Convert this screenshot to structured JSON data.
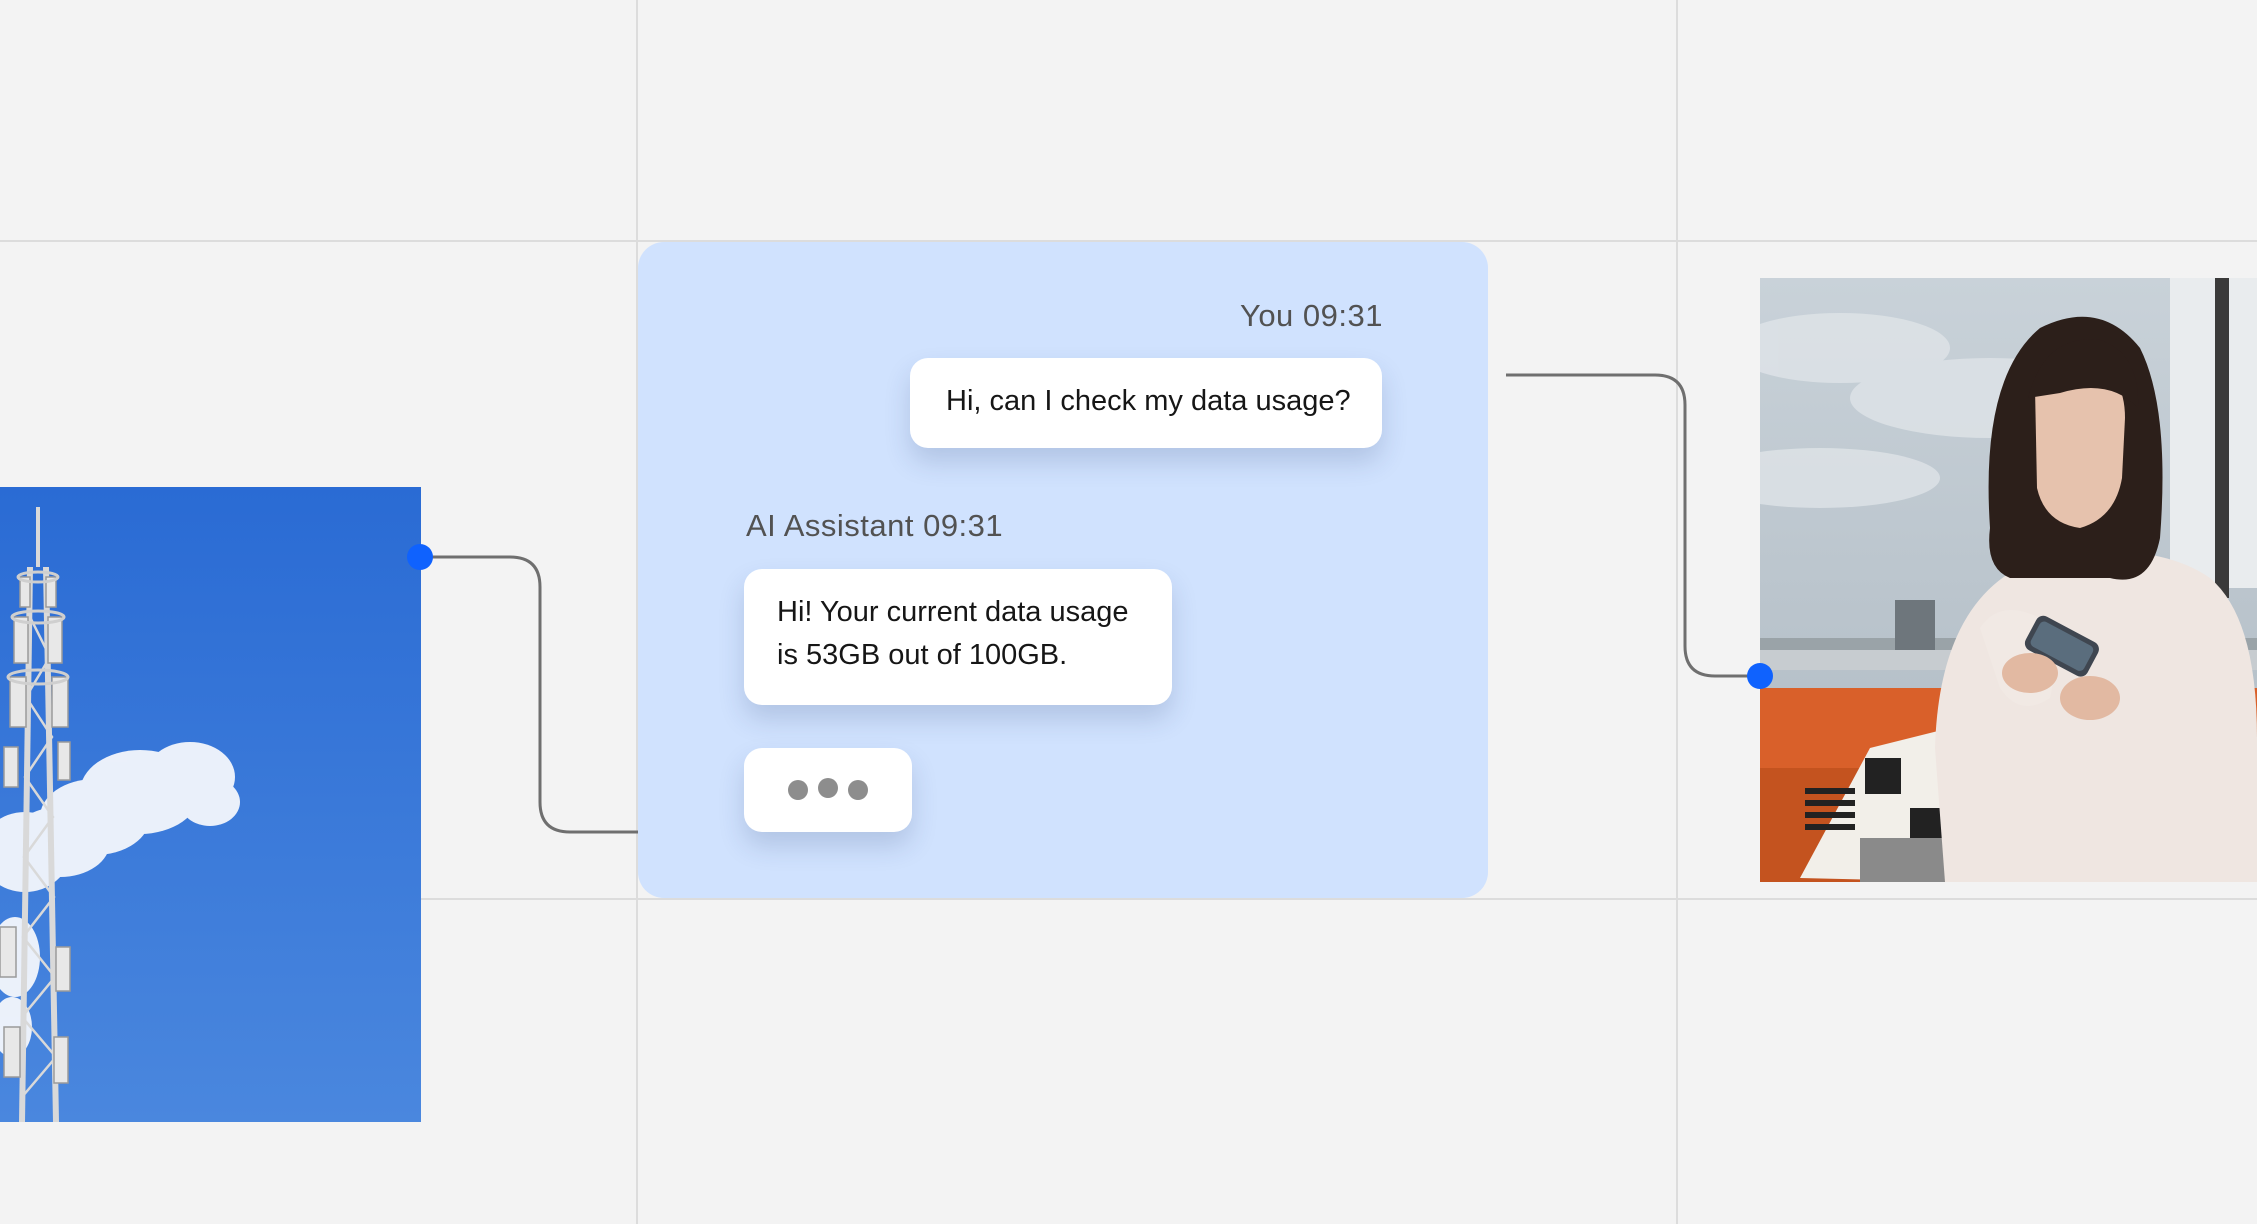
{
  "chat": {
    "messages": [
      {
        "sender": "You",
        "time": "09:31",
        "header": "You 09:31",
        "text": "Hi, can I check my data usage?"
      },
      {
        "sender": "AI Assistant",
        "time": "09:31",
        "header": "AI Assistant 09:31",
        "text": "Hi! Your current data usage is 53GB out of 100GB."
      }
    ],
    "typing_indicator": true
  },
  "colors": {
    "background": "#f3f3f3",
    "panel": "#d0e2fe",
    "accent": "#0f62fe",
    "bubble": "#ffffff",
    "connector": "#6f6f6f"
  },
  "images": {
    "left": "cell-tower-photo",
    "right": "woman-using-phone-photo"
  }
}
